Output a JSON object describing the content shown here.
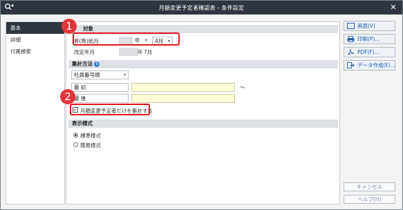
{
  "window": {
    "title": "月額変更予定者確認表 - 条件設定",
    "close_glyph": "✕"
  },
  "sidebar": {
    "items": [
      {
        "label": "基本"
      },
      {
        "label": "詳細"
      },
      {
        "label": "付属検索"
      }
    ]
  },
  "sections": {
    "target": {
      "head": "対象",
      "year_label": "昇(降)給月",
      "year_value": "",
      "year_unit": "年",
      "month_value": "4月",
      "revised_label": "改定年月",
      "revised_year_value": "",
      "revised_year_unit": "年",
      "revised_month": "7月"
    },
    "aggregate": {
      "head": "集計方法",
      "sort_value": "社員番号順",
      "first_label": "最 初",
      "last_label": "最 後",
      "first_value": "",
      "first_name": "",
      "last_value": "",
      "last_name": "",
      "range_mark": "～",
      "only_scheduled_label": "月額変更予定者だけを集計する",
      "only_scheduled_checked": true
    },
    "display": {
      "head": "表示様式",
      "options": [
        {
          "label": "標準様式",
          "selected": true
        },
        {
          "label": "簡易様式",
          "selected": false
        }
      ]
    }
  },
  "actions": {
    "screen": "画面(V)",
    "print": "印刷(P)...",
    "pdf": "PDF(F)...",
    "data": "データ作成(E)...",
    "cancel": "キャンセル",
    "help": "ヘルプ(H)"
  },
  "annotations": {
    "badge1": "1",
    "badge2": "2"
  }
}
